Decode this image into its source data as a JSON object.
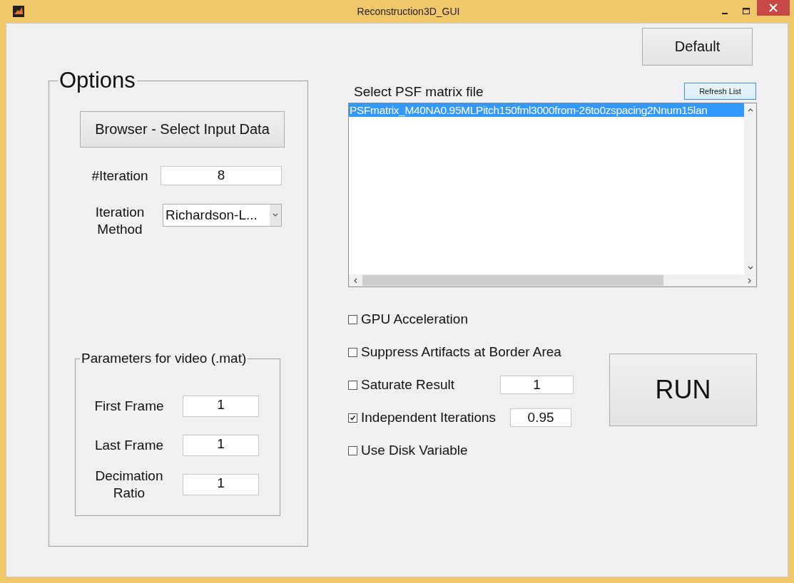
{
  "window": {
    "title": "Reconstruction3D_GUI"
  },
  "default_button": "Default",
  "options": {
    "title": "Options",
    "browse_button": "Browser - Select Input Data",
    "iteration_label": "#Iteration",
    "iteration_value": "8",
    "method_label": "Iteration Method",
    "method_value": "Richardson-L...",
    "video": {
      "title": "Parameters for video (.mat)",
      "fields": [
        {
          "label": "First Frame",
          "value": "1"
        },
        {
          "label": "Last Frame",
          "value": "1"
        },
        {
          "label": "Decimation Ratio",
          "value": "1"
        }
      ]
    }
  },
  "psf": {
    "label": "Select PSF matrix file",
    "refresh_button": "Refresh List",
    "items": [
      {
        "text": "PSFmatrix_M40NA0.95MLPitch150fml3000from-26to0zspacing2Nnum15lan",
        "selected": true
      }
    ]
  },
  "checkboxes": [
    {
      "label": "GPU Acceleration",
      "checked": false
    },
    {
      "label": "Suppress Artifacts at Border Area",
      "checked": false
    },
    {
      "label": "Saturate Result",
      "checked": false,
      "value": "1"
    },
    {
      "label": "Independent Iterations",
      "checked": true,
      "value": "0.95"
    },
    {
      "label": "Use Disk Variable",
      "checked": false
    }
  ],
  "run_button": "RUN"
}
